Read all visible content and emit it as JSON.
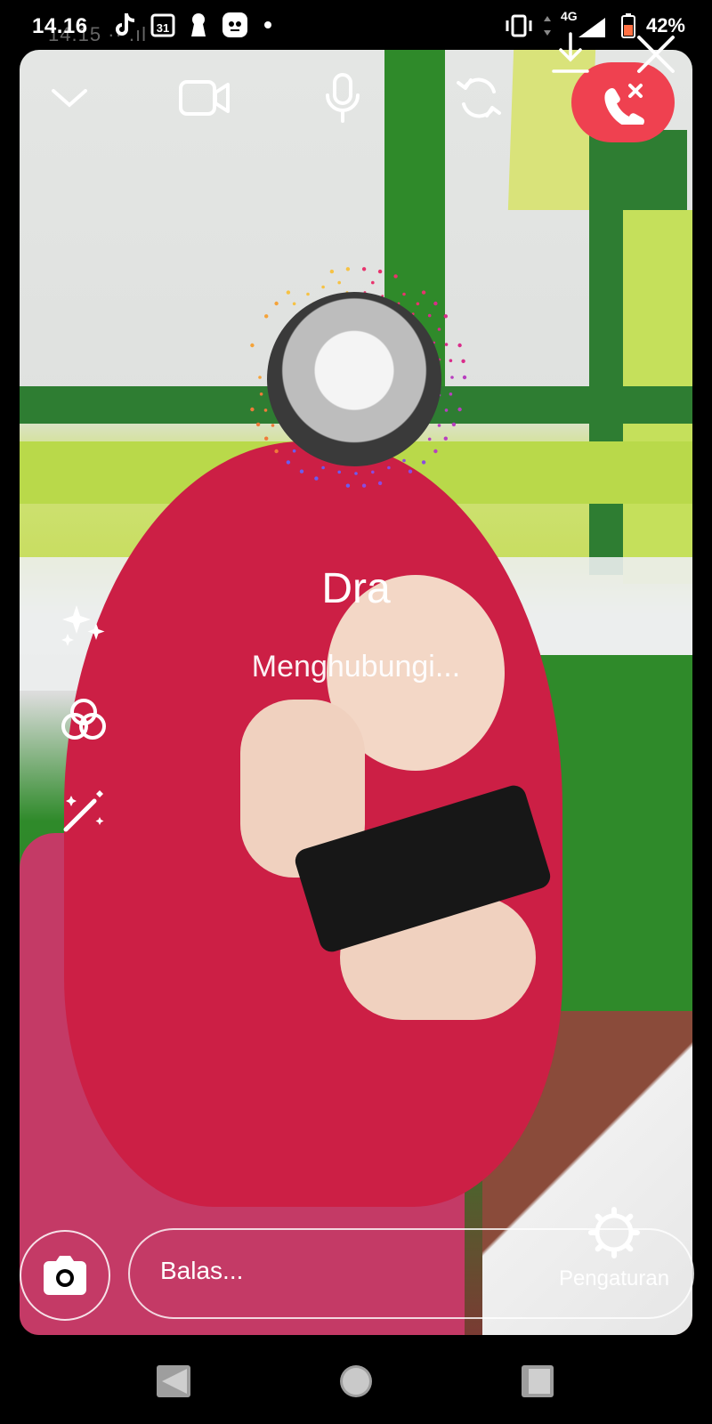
{
  "status_bar": {
    "time": "14.16",
    "ghost_time": "14.15 ·· .ıl",
    "network": "4G",
    "battery": "42%"
  },
  "call": {
    "contact_name": "Dra",
    "status": "Menghubungi..."
  },
  "bottom": {
    "reply_placeholder": "Balas...",
    "settings_label": "Pengaturan"
  },
  "icons": [
    "chevron-down-icon",
    "video-camera-icon",
    "microphone-icon",
    "switch-camera-icon",
    "end-call-icon",
    "close-icon",
    "download-icon",
    "sparkles-icon",
    "filter-circles-icon",
    "magic-wand-icon",
    "camera-icon",
    "gear-icon",
    "back-icon",
    "home-icon",
    "recents-icon"
  ],
  "colors": {
    "end_call": "#ef4150",
    "scarf": "#cc1f45",
    "wall_green": "#2e7d32"
  }
}
